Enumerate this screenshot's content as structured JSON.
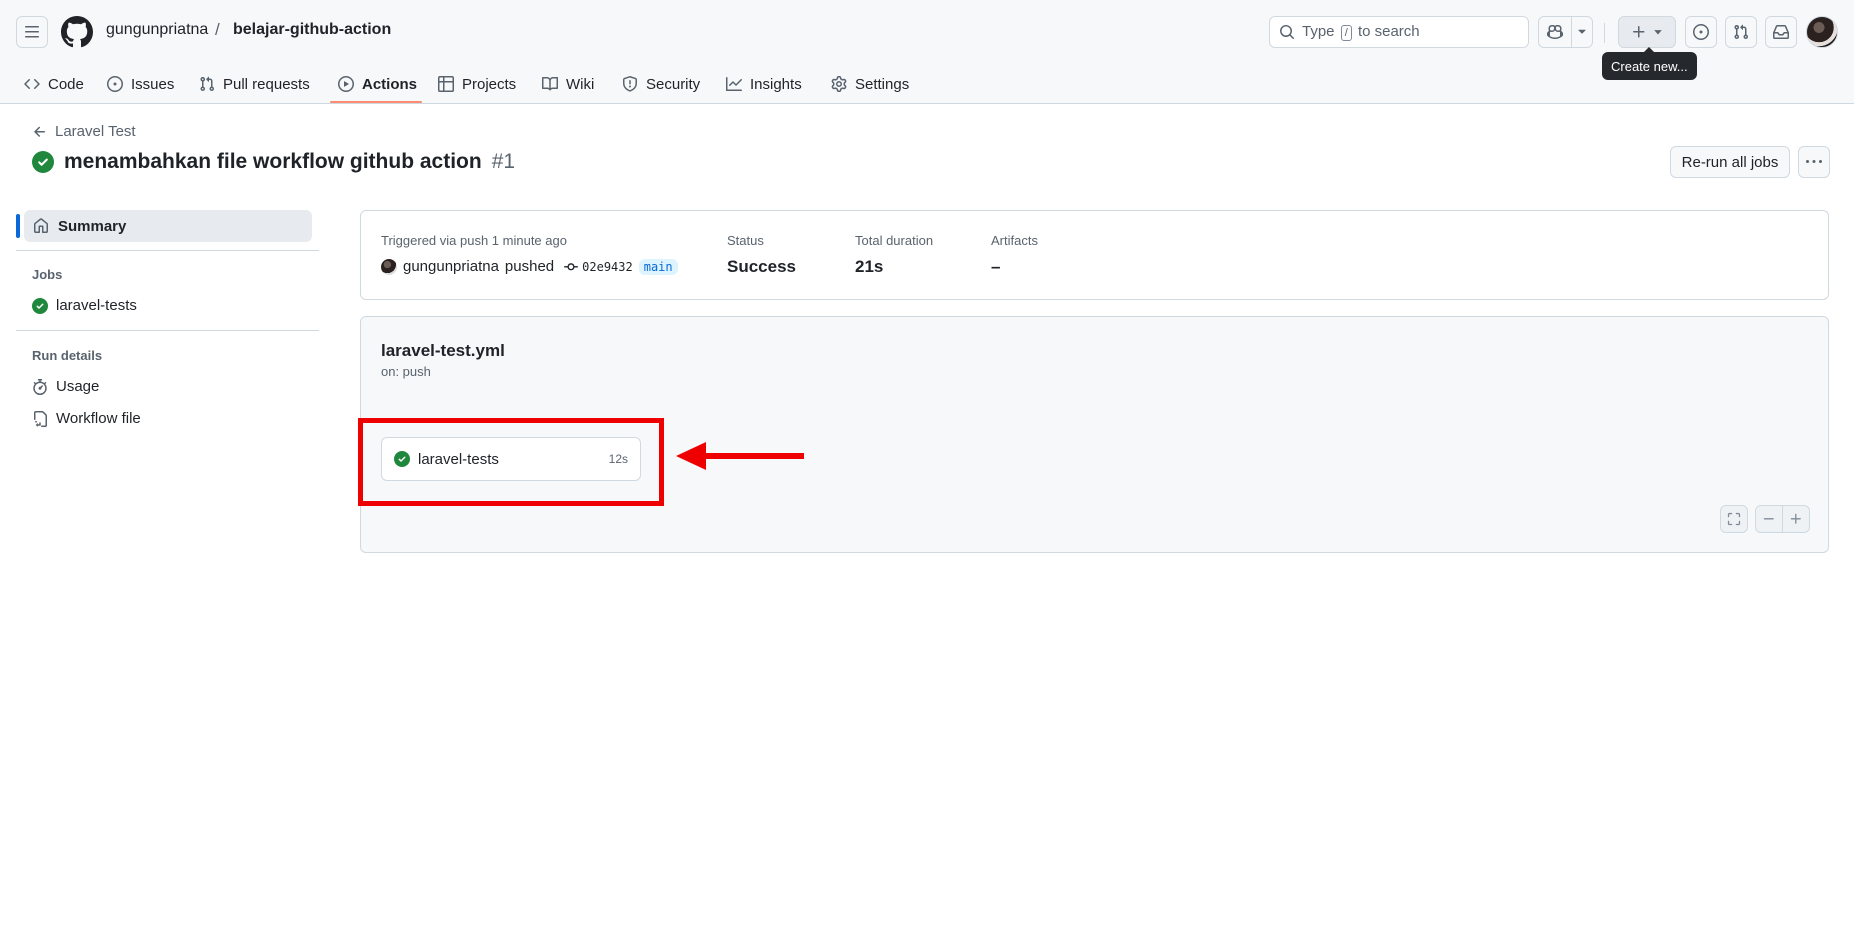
{
  "header": {
    "owner": "gungunpriatna",
    "separator": "/",
    "repo": "belajar-github-action",
    "search": {
      "prefix": "Type",
      "key": "/",
      "suffix": "to search"
    },
    "tooltip": "Create new..."
  },
  "tabs": [
    {
      "label": "Code",
      "icon": "code-icon"
    },
    {
      "label": "Issues",
      "icon": "issue-icon"
    },
    {
      "label": "Pull requests",
      "icon": "pull-request-icon"
    },
    {
      "label": "Actions",
      "icon": "play-icon",
      "active": true
    },
    {
      "label": "Projects",
      "icon": "table-icon"
    },
    {
      "label": "Wiki",
      "icon": "book-icon"
    },
    {
      "label": "Security",
      "icon": "shield-icon"
    },
    {
      "label": "Insights",
      "icon": "graph-icon"
    },
    {
      "label": "Settings",
      "icon": "gear-icon"
    }
  ],
  "run": {
    "back_label": "Laravel Test",
    "title": "menambahkan file workflow github action",
    "number": "#1",
    "rerun_label": "Re-run all jobs"
  },
  "sidebar": {
    "summary_label": "Summary",
    "jobs_heading": "Jobs",
    "jobs": [
      {
        "label": "laravel-tests",
        "status": "success"
      }
    ],
    "run_details_heading": "Run details",
    "details": [
      {
        "label": "Usage",
        "icon": "stopwatch-icon"
      },
      {
        "label": "Workflow file",
        "icon": "workflow-file-icon"
      }
    ]
  },
  "summary": {
    "triggered_label": "Triggered via push 1 minute ago",
    "actor": "gungunpriatna",
    "action": "pushed",
    "commit": "02e9432",
    "branch": "main",
    "status_label": "Status",
    "status_value": "Success",
    "duration_label": "Total duration",
    "duration_value": "21s",
    "artifacts_label": "Artifacts",
    "artifacts_value": "–"
  },
  "workflow": {
    "file": "laravel-test.yml",
    "trigger": "on: push",
    "job": {
      "name": "laravel-tests",
      "duration": "12s"
    }
  },
  "colors": {
    "success": "#1f883d",
    "accent": "#0969da",
    "tab_underline": "#fd8c73",
    "annotation": "#ef0000"
  }
}
